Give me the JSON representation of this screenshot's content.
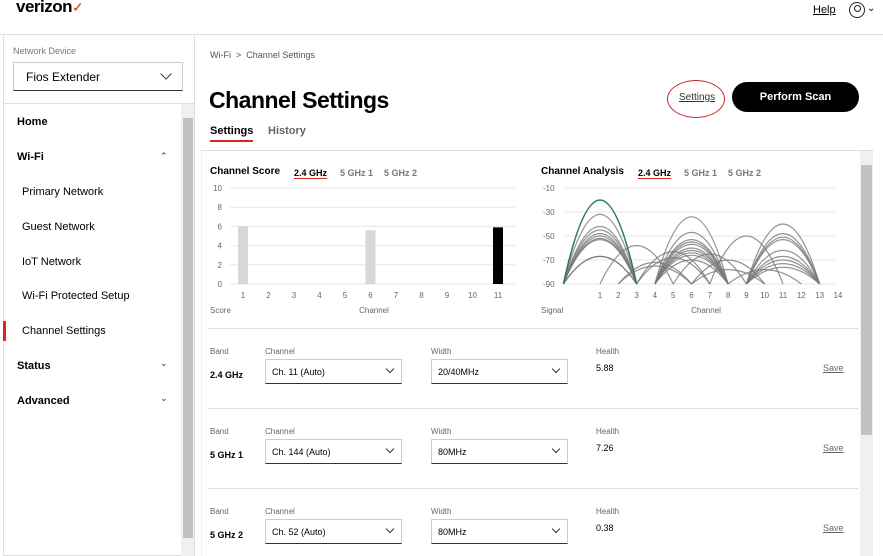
{
  "header": {
    "logo": "verizon",
    "help": "Help"
  },
  "sidebar": {
    "device_label": "Network Device",
    "device_value": "Fios Extender",
    "items": [
      {
        "label": "Home"
      },
      {
        "label": "Wi-Fi"
      },
      {
        "label": "Primary Network"
      },
      {
        "label": "Guest Network"
      },
      {
        "label": "IoT Network"
      },
      {
        "label": "Wi-Fi Protected Setup"
      },
      {
        "label": "Channel Settings"
      },
      {
        "label": "Status"
      },
      {
        "label": "Advanced"
      }
    ]
  },
  "main": {
    "breadcrumb": [
      "Wi-Fi",
      "Channel Settings"
    ],
    "breadcrumb_sep": ">",
    "title": "Channel Settings",
    "settings_link": "Settings",
    "scan_button": "Perform Scan",
    "tabs": [
      {
        "label": "Settings"
      },
      {
        "label": "History"
      }
    ],
    "band_tabs": [
      "2.4 GHz",
      "5 GHz 1",
      "5 GHz 2"
    ],
    "labels": {
      "band": "Band",
      "channel": "Channel",
      "width": "Width",
      "health": "Health",
      "save": "Save"
    },
    "rows": [
      {
        "band": "2.4 GHz",
        "channel": "Ch. 11 (Auto)",
        "width": "20/40MHz",
        "health": "5.88"
      },
      {
        "band": "5 GHz 1",
        "channel": "Ch. 144 (Auto)",
        "width": "80MHz",
        "health": "7.26"
      },
      {
        "band": "5 GHz 2",
        "channel": "Ch. 52 (Auto)",
        "width": "80MHz",
        "health": "0.38"
      }
    ]
  },
  "colors": {
    "accent": "#d52b1e",
    "selected_bar": "#000000",
    "bar": "#d8d8d8",
    "own_network": "#2e7d5b",
    "network": "#777777"
  },
  "chart_data": [
    {
      "type": "bar",
      "title": "Channel Score",
      "xlabel": "Channel",
      "ylabel": "Score",
      "ylim": [
        0,
        10
      ],
      "yticks": [
        0,
        2,
        4,
        6,
        8,
        10
      ],
      "categories": [
        "1",
        "2",
        "3",
        "4",
        "5",
        "6",
        "7",
        "8",
        "9",
        "10",
        "11"
      ],
      "values": [
        6,
        0,
        0,
        0,
        0,
        5.6,
        0,
        0,
        0,
        0,
        5.9
      ],
      "selected": "11"
    },
    {
      "type": "line",
      "title": "Channel Analysis",
      "xlabel": "Channel",
      "ylabel": "Signal",
      "ylim": [
        -90,
        -10
      ],
      "yticks": [
        -10,
        -30,
        -50,
        -70,
        -90
      ],
      "xticks": [
        1,
        2,
        3,
        4,
        5,
        6,
        7,
        8,
        9,
        10,
        11,
        12,
        13,
        14
      ],
      "networks": [
        {
          "c": 1,
          "s": -20,
          "own": true
        },
        {
          "c": 1,
          "s": -32
        },
        {
          "c": 1,
          "s": -42
        },
        {
          "c": 1,
          "s": -45
        },
        {
          "c": 1,
          "s": -48
        },
        {
          "c": 1,
          "s": -50
        },
        {
          "c": 1,
          "s": -52
        },
        {
          "c": 1,
          "s": -53
        },
        {
          "c": 1,
          "s": -67
        },
        {
          "c": 1,
          "s": -67
        },
        {
          "c": 3,
          "s": -58
        },
        {
          "c": 4,
          "s": -72
        },
        {
          "c": 5,
          "s": -63
        },
        {
          "c": 5,
          "s": -68
        },
        {
          "c": 4,
          "s": -75
        },
        {
          "c": 6,
          "s": -34
        },
        {
          "c": 6,
          "s": -47
        },
        {
          "c": 6,
          "s": -53
        },
        {
          "c": 6,
          "s": -55
        },
        {
          "c": 6,
          "s": -57
        },
        {
          "c": 6,
          "s": -60
        },
        {
          "c": 6,
          "s": -62
        },
        {
          "c": 6,
          "s": -64
        },
        {
          "c": 6,
          "s": -66
        },
        {
          "c": 6,
          "s": -70
        },
        {
          "c": 7,
          "s": -65
        },
        {
          "c": 8,
          "s": -70
        },
        {
          "c": 9,
          "s": -50
        },
        {
          "c": 8,
          "s": -78
        },
        {
          "c": 11,
          "s": -40
        },
        {
          "c": 11,
          "s": -48
        },
        {
          "c": 11,
          "s": -51
        },
        {
          "c": 11,
          "s": -53
        },
        {
          "c": 11,
          "s": -62
        },
        {
          "c": 11,
          "s": -67
        },
        {
          "c": 11,
          "s": -70
        },
        {
          "c": 11,
          "s": -73
        },
        {
          "c": 11,
          "s": -76
        },
        {
          "c": 10,
          "s": -78
        }
      ]
    }
  ]
}
